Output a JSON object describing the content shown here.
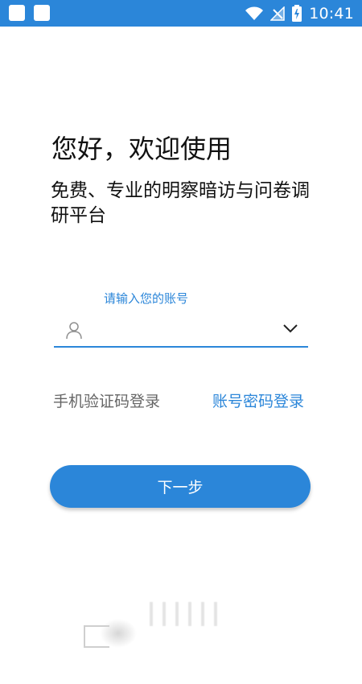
{
  "status_bar": {
    "time": "10:41",
    "background": "#2b86d9",
    "icons": [
      "app-notification-icon",
      "app-notification-icon",
      "wifi-icon",
      "no-signal-icon",
      "battery-charging-icon"
    ]
  },
  "header": {
    "greeting": "您好，欢迎使用",
    "subtitle": "免费、专业的明察暗访与问卷调研平台"
  },
  "account": {
    "label": "请输入您的账号",
    "value": "",
    "icon": "user-icon",
    "dropdown_icon": "chevron-down-icon"
  },
  "login_options": {
    "sms_login": "手机验证码登录",
    "password_login": "账号密码登录"
  },
  "next_button": {
    "label": "下一步"
  },
  "colors": {
    "accent": "#2b86d9",
    "text": "#111111",
    "secondary_text": "#666666"
  }
}
